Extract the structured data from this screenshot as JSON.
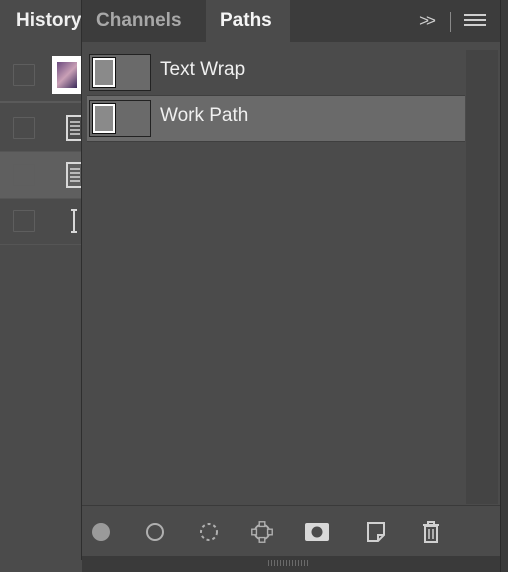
{
  "history": {
    "tab_label": "History",
    "rows": [
      {
        "icon": "document-icon",
        "selected": false
      },
      {
        "icon": "document-icon",
        "selected": true
      },
      {
        "icon": "text-cursor-icon",
        "selected": false
      }
    ]
  },
  "paths_panel": {
    "tabs": [
      {
        "label": "Channels",
        "active": false
      },
      {
        "label": "Paths",
        "active": true
      }
    ],
    "collapse_label": ">>",
    "paths": [
      {
        "name": "Text Wrap",
        "selected": false
      },
      {
        "name": "Work Path",
        "selected": true
      }
    ],
    "footer_buttons": [
      "fill-path-icon",
      "stroke-path-icon",
      "load-as-selection-icon",
      "make-work-path-icon",
      "add-mask-icon",
      "new-path-icon",
      "trash-icon"
    ]
  }
}
